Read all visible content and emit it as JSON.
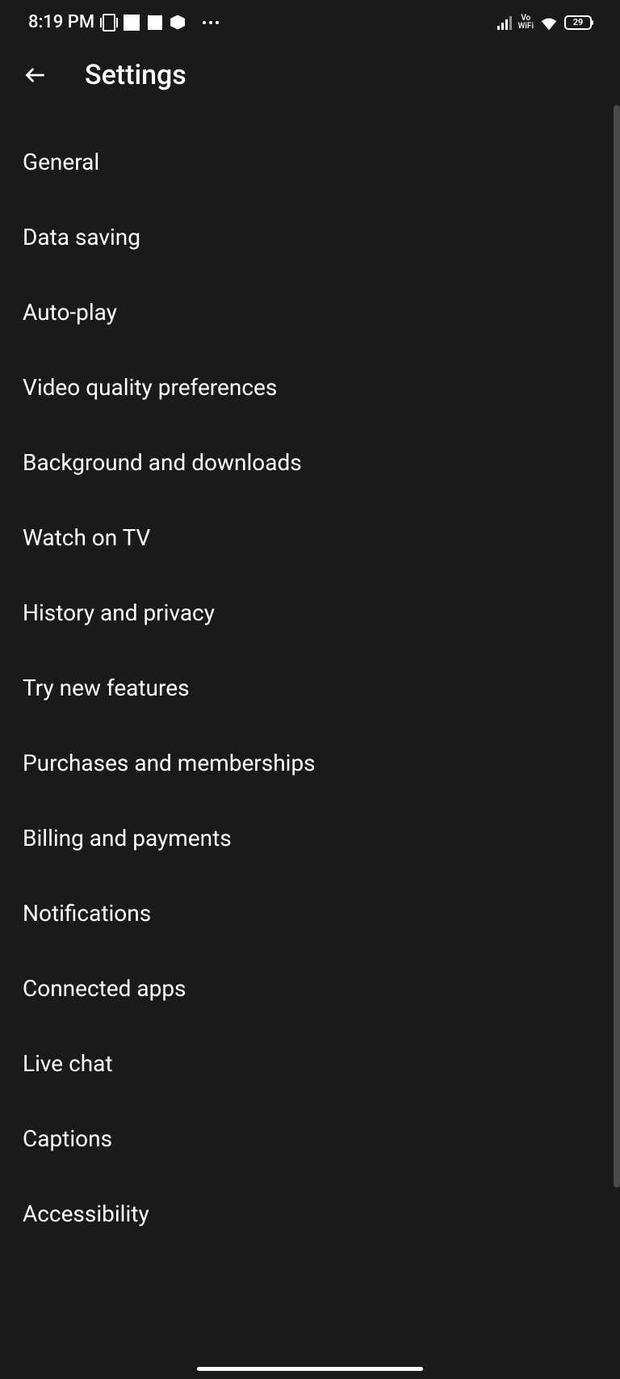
{
  "statusBar": {
    "time": "8:19 PM",
    "vowifi_top": "Vo",
    "vowifi_bottom": "WiFi",
    "battery": "29"
  },
  "header": {
    "title": "Settings"
  },
  "settings": {
    "items": [
      {
        "label": "General"
      },
      {
        "label": "Data saving"
      },
      {
        "label": "Auto-play"
      },
      {
        "label": "Video quality preferences"
      },
      {
        "label": "Background and downloads"
      },
      {
        "label": "Watch on TV"
      },
      {
        "label": "History and privacy"
      },
      {
        "label": "Try new features"
      },
      {
        "label": "Purchases and memberships"
      },
      {
        "label": "Billing and payments"
      },
      {
        "label": "Notifications"
      },
      {
        "label": "Connected apps"
      },
      {
        "label": "Live chat"
      },
      {
        "label": "Captions"
      },
      {
        "label": "Accessibility"
      }
    ]
  }
}
